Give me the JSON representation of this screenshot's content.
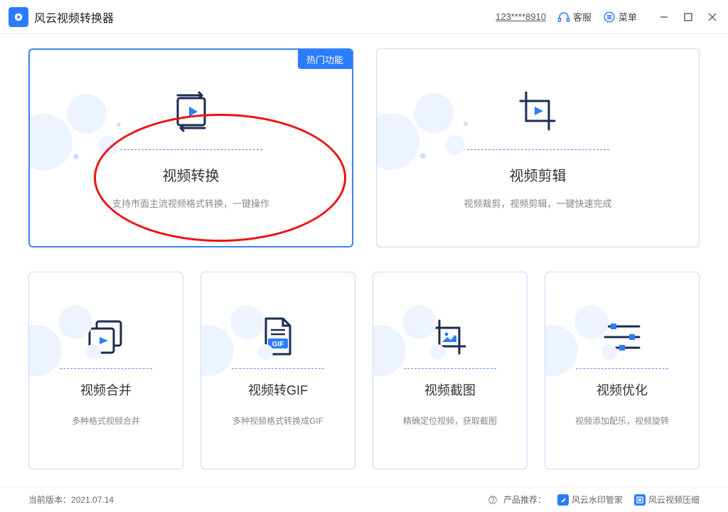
{
  "app": {
    "title": "风云视频转换器"
  },
  "titlebar": {
    "user_id": "123****8910",
    "service_label": "客服",
    "menu_label": "菜单"
  },
  "hot_badge": "热门功能",
  "cards": {
    "convert": {
      "title": "视频转换",
      "desc": "支持市面主流视频格式转换，一键操作"
    },
    "edit": {
      "title": "视频剪辑",
      "desc": "视频裁剪，视频剪辑，一键快速完成"
    },
    "merge": {
      "title": "视频合并",
      "desc": "多种格式视频合并"
    },
    "gif": {
      "title": "视频转GIF",
      "desc": "多种视频格式转换成GIF",
      "gif_label": "GIF"
    },
    "snap": {
      "title": "视频截图",
      "desc": "精确定位视频，获取截图"
    },
    "optimize": {
      "title": "视频优化",
      "desc": "视频添加配乐，视频旋转"
    }
  },
  "footer": {
    "version_label": "当前版本：",
    "version": "2021.07.14",
    "recommend_label": "产品推荐：",
    "rec1": "风云水印管家",
    "rec2": "风云视频压缩"
  }
}
